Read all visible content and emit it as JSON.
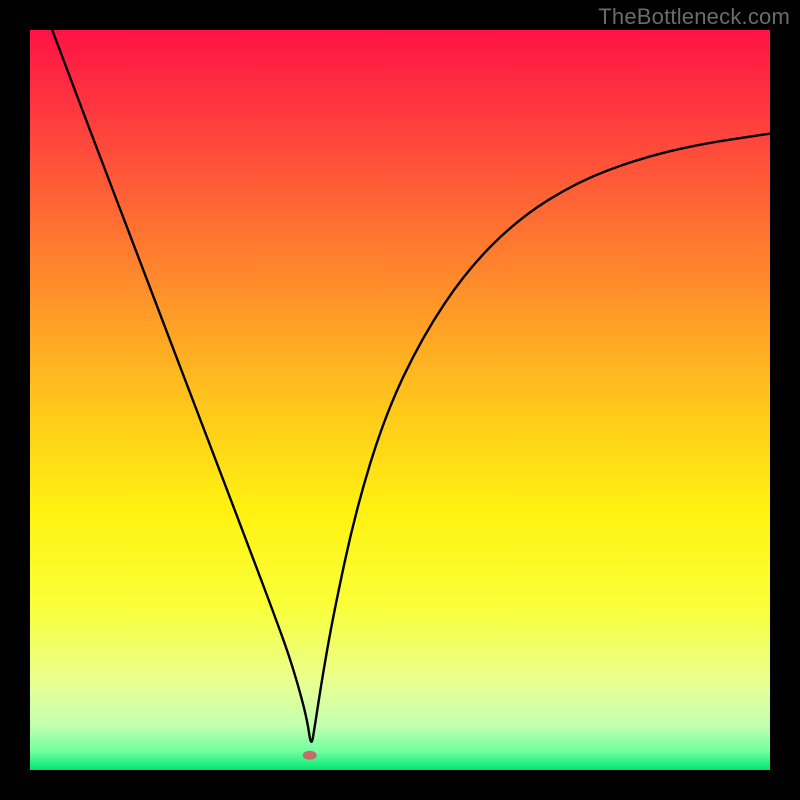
{
  "watermark": "TheBottleneck.com",
  "chart_data": {
    "type": "line",
    "title": "",
    "xlabel": "",
    "ylabel": "",
    "xlim": [
      0,
      100
    ],
    "ylim": [
      0,
      100
    ],
    "grid": false,
    "background_gradient": {
      "stops": [
        {
          "offset": 0.0,
          "color": "#ff1246"
        },
        {
          "offset": 0.12,
          "color": "#ff3c3e"
        },
        {
          "offset": 0.3,
          "color": "#ff7d2f"
        },
        {
          "offset": 0.5,
          "color": "#ffc41c"
        },
        {
          "offset": 0.65,
          "color": "#fff210"
        },
        {
          "offset": 0.78,
          "color": "#f9ff3a"
        },
        {
          "offset": 0.88,
          "color": "#eaff90"
        },
        {
          "offset": 0.94,
          "color": "#c3ffb0"
        },
        {
          "offset": 0.975,
          "color": "#6fff9d"
        },
        {
          "offset": 1.0,
          "color": "#00e573"
        }
      ]
    },
    "series": [
      {
        "name": "curve",
        "color": "#000000",
        "x": [
          3,
          6,
          10,
          14,
          18,
          22,
          26,
          30,
          33,
          35,
          36.5,
          37.5,
          38,
          38.5,
          39.5,
          41,
          44,
          48,
          53,
          59,
          66,
          74,
          82,
          90,
          100
        ],
        "y": [
          100,
          92,
          81.5,
          71,
          60.5,
          50,
          39.5,
          29,
          21,
          15.5,
          10.5,
          6.5,
          3,
          6,
          12.5,
          21,
          35,
          48,
          58.5,
          67.5,
          74.5,
          79.5,
          82.5,
          84.5,
          86
        ]
      }
    ],
    "markers": [
      {
        "name": "min-marker",
        "x": 37.8,
        "y": 2.0,
        "rx": 7,
        "ry": 4.5,
        "color": "#c66a6a"
      }
    ]
  }
}
